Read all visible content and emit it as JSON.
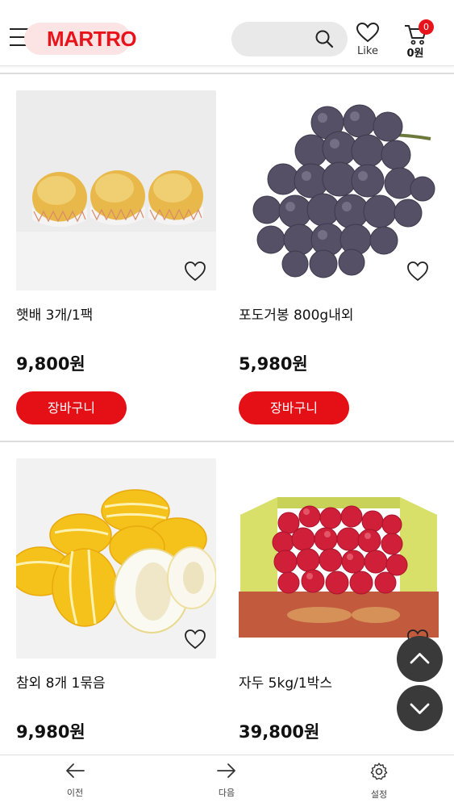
{
  "header": {
    "logo": "MARTRO",
    "like_label": "Like",
    "cart_count": "0",
    "cart_total": "0원",
    "icons": [
      "menu-icon",
      "search-icon",
      "heart-icon",
      "cart-icon"
    ],
    "brand_color": "#e8141c"
  },
  "products": [
    {
      "name": "햇배 3개/1팩",
      "price": "9,800원",
      "button": "장바구니"
    },
    {
      "name": "포도거봉 800g내외",
      "price": "5,980원",
      "button": "장바구니"
    },
    {
      "name": "참외 8개 1묶음",
      "price": "9,980원"
    },
    {
      "name": "자두 5kg/1박스",
      "price": "39,800원"
    }
  ],
  "bottom_nav": {
    "prev": "이전",
    "next": "다음",
    "settings": "설정"
  }
}
